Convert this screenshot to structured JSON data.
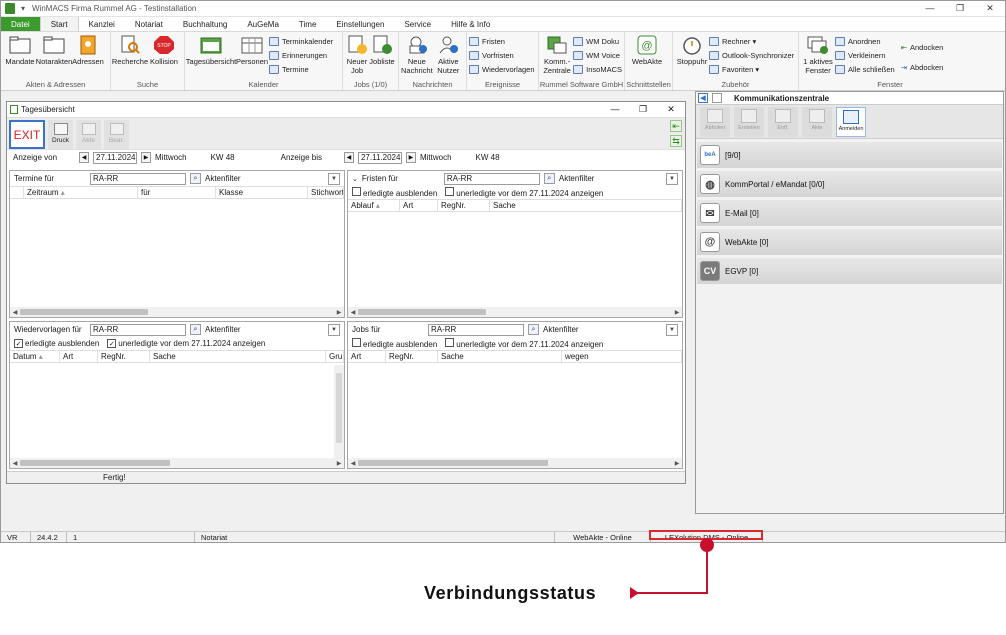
{
  "window": {
    "title": "WinMACS Firma Rummel AG - Testinstallation"
  },
  "menu": {
    "items": [
      "Datei",
      "Start",
      "Kanzlei",
      "Notariat",
      "Buchhaltung",
      "AuGeMa",
      "Time",
      "Einstellungen",
      "Service",
      "Hilfe & Info"
    ]
  },
  "ribbon": {
    "groups": [
      {
        "caption": "Akten & Adressen",
        "buttons": [
          "Mandate",
          "Notarakten",
          "Adressen"
        ]
      },
      {
        "caption": "Suche",
        "buttons": [
          "Recherche",
          "Kollision"
        ]
      },
      {
        "caption": "Kalender",
        "buttons": [
          "Tagesübersicht",
          "Personen"
        ],
        "small": [
          "Terminkalender",
          "Erinnerungen",
          "Termine"
        ]
      },
      {
        "caption": "Jobs (1/0)",
        "buttons": [
          "Neuer Job",
          "Jobliste"
        ]
      },
      {
        "caption": "Nachrichten",
        "buttons": [
          "Neue Nachricht",
          "Aktive Nutzer"
        ]
      },
      {
        "caption": "Ereignisse",
        "small": [
          "Fristen",
          "Vorfristen",
          "Wiedervorlagen"
        ]
      },
      {
        "caption": "Rummel Software GmbH",
        "buttons": [
          "Komm.-Zentrale"
        ],
        "small": [
          "WM Doku",
          "WM Voice",
          "InsoMACS"
        ]
      },
      {
        "caption": "Schnittstellen",
        "buttons": [
          "WebAkte"
        ]
      },
      {
        "caption": "Zubehör",
        "buttons": [
          "Stoppuhr"
        ],
        "small": [
          "Rechner",
          "Outlook-Synchronizer",
          "Favoriten"
        ]
      },
      {
        "caption": "Fenster",
        "buttons": [
          "1 aktives Fenster"
        ],
        "small": [
          "Anordnen",
          "Verkleinern",
          "Alle schließen",
          "Andocken",
          "Abdocken"
        ]
      }
    ]
  },
  "tages": {
    "title": "Tagesübersicht",
    "tools": {
      "exit": "EXIT",
      "druck": "Druck",
      "akte": "Akte",
      "bear": "Bear."
    },
    "dates": {
      "von_label": "Anzeige von",
      "von": "27.11.2024",
      "von_day": "Mittwoch",
      "von_kw": "KW 48",
      "bis_label": "Anzeige bis",
      "bis": "27.11.2024",
      "bis_day": "Mittwoch",
      "bis_kw": "KW 48"
    },
    "termine": {
      "label": "Termine für",
      "value": "RA-RR",
      "filter": "Aktenfilter",
      "columns": [
        "Zeitraum",
        "für",
        "Klasse",
        "Stichwort"
      ]
    },
    "fristen": {
      "label": "Fristen für",
      "value": "RA-RR",
      "filter": "Aktenfilter",
      "check1": "erledigte ausblenden",
      "check2": "unerledigte vor dem 27.11.2024 anzeigen",
      "columns": [
        "Ablauf",
        "Art",
        "RegNr.",
        "Sache"
      ]
    },
    "wiedervorlagen": {
      "label": "Wiedervorlagen für",
      "value": "RA-RR",
      "filter": "Aktenfilter",
      "check1": "erledigte ausblenden",
      "check2": "unerledigte vor dem 27.11.2024 anzeigen",
      "columns": [
        "Datum",
        "Art",
        "RegNr.",
        "Sache",
        "Gru"
      ]
    },
    "jobs": {
      "label": "Jobs für",
      "value": "RA-RR",
      "filter": "Aktenfilter",
      "check1": "erledigte ausblenden",
      "check2": "unerledigte vor dem 27.11.2024 anzeigen",
      "columns": [
        "Art",
        "RegNr.",
        "Sache",
        "wegen"
      ]
    },
    "status": "Fertig!"
  },
  "kommunikation": {
    "title": "Kommunikationszentrale",
    "tools": [
      "Abholen",
      "Erstellen",
      "Entf.",
      "Akte",
      "Anmelden"
    ],
    "items": [
      {
        "icon": "beA",
        "label": "[9/0]"
      },
      {
        "icon": "globe",
        "label": "KommPortal / eMandat [0/0]"
      },
      {
        "icon": "mail",
        "label": "E-Mail [0]"
      },
      {
        "icon": "@",
        "label": "WebAkte [0]"
      },
      {
        "icon": "CV",
        "label": "EGVP [0]"
      }
    ]
  },
  "statusbar": {
    "user": "VR",
    "version": "24.4.2",
    "count": "1",
    "module": "Notariat",
    "webakte": "WebAkte - Online",
    "dms": "LEXolution.DMS - Online"
  },
  "annotation": {
    "label": "Verbindungsstatus",
    "color": "#c8102e"
  }
}
